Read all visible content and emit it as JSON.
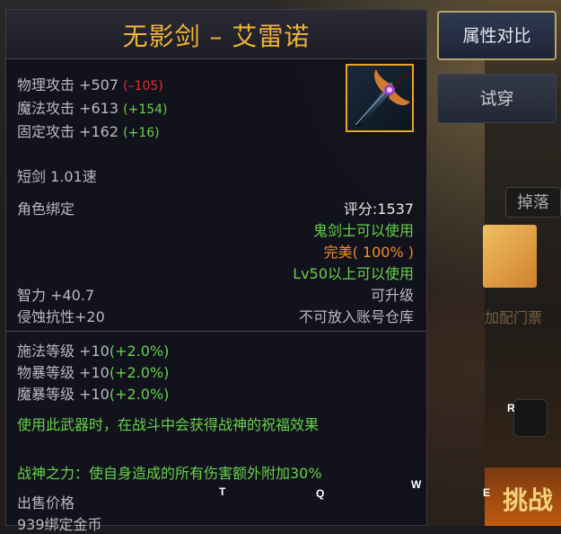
{
  "item": {
    "name": "无影剑 – 艾雷诺",
    "stats": [
      {
        "label": "物理攻击 +507",
        "delta": "(–105)",
        "delta_color": "red"
      },
      {
        "label": "魔法攻击 +613",
        "delta": "(+154)",
        "delta_color": "green"
      },
      {
        "label": "固定攻击 +162",
        "delta": "(+16)",
        "delta_color": "green"
      }
    ],
    "weapon_type": "短剑 1.01速",
    "binding": "角色绑定",
    "score": "评分:1537",
    "usable_class": "鬼剑士可以使用",
    "quality": "完美( 100% )",
    "level_req": "Lv50以上可以使用",
    "int_stat": "智力 +40.7",
    "upgrade": "可升级",
    "corrosion": "侵蚀抗性+20",
    "storage": "不可放入账号仓库",
    "levels": [
      {
        "label": "施法等级 +10",
        "bonus": "(+2.0%)"
      },
      {
        "label": "物暴等级 +10",
        "bonus": "(+2.0%)"
      },
      {
        "label": "魔暴等级 +10",
        "bonus": "(+2.0%)"
      }
    ],
    "effect": "使用此武器时，在战斗中会获得战神的祝福效果",
    "effect2": "战神之力：使自身造成的所有伤害额外附加30%",
    "price_label": "出售价格",
    "price_value": "939绑定金币",
    "icon": "sword-icon"
  },
  "buttons": {
    "compare": "属性对比",
    "try_on": "试穿"
  },
  "background": {
    "dropdown_text": "掉落",
    "card_text": "加配门票",
    "bottom_text": "挑战"
  },
  "hotkeys": {
    "t": "T",
    "q": "Q",
    "w": "W",
    "e": "E",
    "r": "R"
  },
  "colors": {
    "title": "#f0b436",
    "icon_border": "#e9a52a",
    "green": "#66d24a",
    "red": "#e0322e",
    "orange": "#f08c2a"
  }
}
